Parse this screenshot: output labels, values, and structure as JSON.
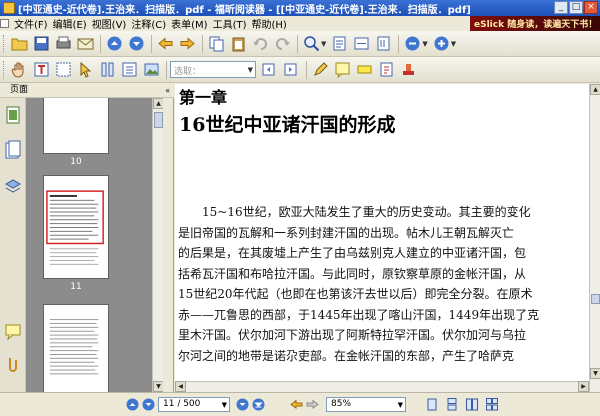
{
  "window": {
    "title": "[中亚通史-近代卷].王治来．扫描版．pdf - 福昕阅读器 - [[中亚通史-近代卷].王治来．扫描版．pdf]",
    "controls": [
      "_",
      "□",
      "×"
    ]
  },
  "menu": {
    "items": [
      "文件(F)",
      "编辑(E)",
      "视图(V)",
      "注释(C)",
      "表单(M)",
      "工具(T)",
      "帮助(H)"
    ],
    "brand": "eSlick 随身读，读遍天下书！"
  },
  "toolbar2": {
    "select_placeholder": "选取："
  },
  "sidebar": {
    "header": "页面",
    "collapse_glyph": "«",
    "thumbnails": [
      {
        "label": "10"
      },
      {
        "label": "11"
      },
      {
        "label": ""
      }
    ]
  },
  "document": {
    "chapter": "第一章",
    "title": "16世纪中亚诸汗国的形成",
    "lines": [
      "　　15~16世纪，欧亚大陆发生了重大的历史变动。其主要的变化",
      "是旧帝国的瓦解和一系列封建汗国的出现。帖木儿王朝瓦解灭亡",
      "的后果是，在其废墟上产生了由乌兹别克人建立的中亚诸汗国，包",
      "括希瓦汗国和布哈拉汗国。与此同时，原钦察草原的金帐汗国，从",
      "15世纪20年代起（也即在也第该汗去世以后）即完全分裂。在原术",
      "赤——兀鲁思的西部，于1445年出现了喀山汗国，1449年出现了克",
      "里木汗国。伏尔加河下游出现了阿斯特拉罕汗国。伏尔加河与乌拉",
      "尔河之间的地带是诺尕吏部。在金帐汗国的东部，产生了哈萨克"
    ]
  },
  "statusbar": {
    "page_value": "11 / 500",
    "zoom_value": "85%"
  },
  "colors": {
    "titlebar": "#1c4fb8",
    "accent_blue": "#3f77d0",
    "thumb_panel": "#8c8c8c",
    "highlight_red": "#d32020"
  }
}
